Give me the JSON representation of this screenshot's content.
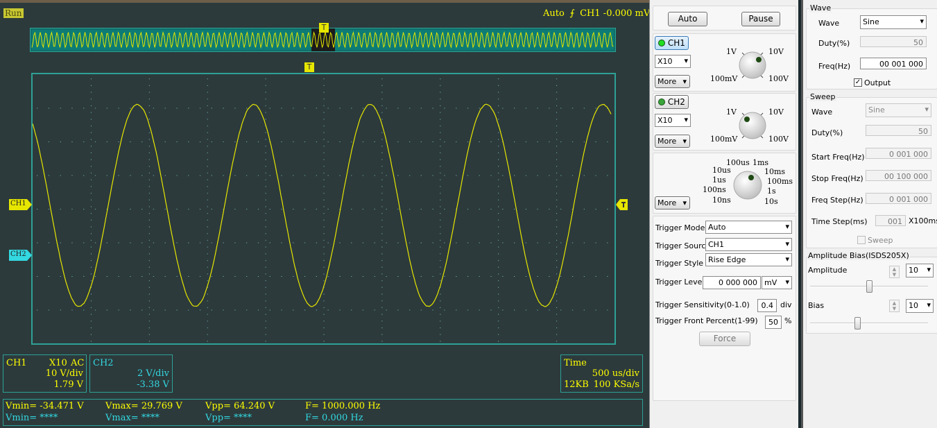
{
  "scope": {
    "run_label": "Run",
    "trigger_status": {
      "mode": "Auto",
      "channel": "CH1",
      "value": "-0.000 mV"
    },
    "trigger_marker": "T",
    "ch1_marker": "CH1",
    "ch2_marker": "CH2",
    "waveform": {
      "period_div": 2.0,
      "amplitude_div": 3.0,
      "offset_div": 0.1,
      "start_phase_div": 1.3
    }
  },
  "info": {
    "ch1": {
      "name": "CH1",
      "probe": "X10",
      "coupling": "AC",
      "volts_div": "10 V/div",
      "offset": "1.79 V"
    },
    "ch2": {
      "name": "CH2",
      "volts_div": "2 V/div",
      "offset": "-3.38 V"
    },
    "time": {
      "label": "Time",
      "time_div": "500 us/div",
      "memory": "12KB",
      "sample_rate": "100 KSa/s"
    }
  },
  "measure": {
    "row1": {
      "vmin": "Vmin= -34.471 V",
      "vmax": "Vmax= 29.769 V",
      "vpp": "Vpp= 64.240 V",
      "freq": "F= 1000.000 Hz"
    },
    "row2": {
      "vmin": "Vmin= ****",
      "vmax": "Vmax= ****",
      "vpp": "Vpp= ****",
      "freq": "F= 0.000 Hz"
    }
  },
  "panel": {
    "auto_button": "Auto",
    "pause_button": "Pause",
    "ch1": {
      "button": "CH1",
      "probe": "X10",
      "more": "More",
      "knob": {
        "tl": "1V",
        "tr": "10V",
        "bl": "100mV",
        "br": "100V"
      }
    },
    "ch2": {
      "button": "CH2",
      "probe": "X10",
      "more": "More",
      "knob": {
        "tl": "1V",
        "tr": "10V",
        "bl": "100mV",
        "br": "100V"
      }
    },
    "time_knob": {
      "more": "More",
      "labels": {
        "t100us": "100us",
        "t1ms": "1ms",
        "t10us": "10us",
        "t10ms": "10ms",
        "t1us": "1us",
        "t100ms": "100ms",
        "t100ns": "100ns",
        "t1s": "1s",
        "t10ns": "10ns",
        "t10s": "10s"
      }
    },
    "trigger": {
      "mode_label": "Trigger Mode",
      "mode_value": "Auto",
      "source_label": "Trigger Source",
      "source_value": "CH1",
      "style_label": "Trigger Style",
      "style_value": "Rise Edge",
      "level_label": "Trigger Level",
      "level_value": "0 000 000",
      "level_unit": "mV",
      "sens_label": "Trigger Sensitivity(0-1.0)",
      "sens_value": "0.4",
      "sens_unit": "div",
      "front_label": "Trigger Front Percent(1-99)",
      "front_value": "50",
      "front_unit": "%",
      "force_button": "Force"
    }
  },
  "generator": {
    "wave_group": "Wave",
    "wave_label": "Wave",
    "wave_value": "Sine",
    "duty_label": "Duty(%)",
    "duty_value": "50",
    "freq_label": "Freq(Hz)",
    "freq_value": "00 001 000",
    "output_label": "Output",
    "sweep_group": "Sweep",
    "sweep_wave_label": "Wave",
    "sweep_wave_value": "Sine",
    "sweep_duty_label": "Duty(%)",
    "sweep_duty_value": "50",
    "start_label": "Start Freq(Hz)",
    "start_value": "0 001 000",
    "stop_label": "Stop Freq(Hz)",
    "stop_value": "00 100 000",
    "step_label": "Freq Step(Hz)",
    "step_value": "0 001 000",
    "time_label": "Time Step(ms)",
    "time_value": "001",
    "time_unit": "X100ms",
    "sweep_check": "Sweep",
    "amp_group": "Amplitude Bias(ISDS205X)",
    "amp_label": "Amplitude",
    "amp_value": "10",
    "amp_slider": 0.5,
    "bias_label": "Bias",
    "bias_value": "10",
    "bias_slider": 0.4
  }
}
